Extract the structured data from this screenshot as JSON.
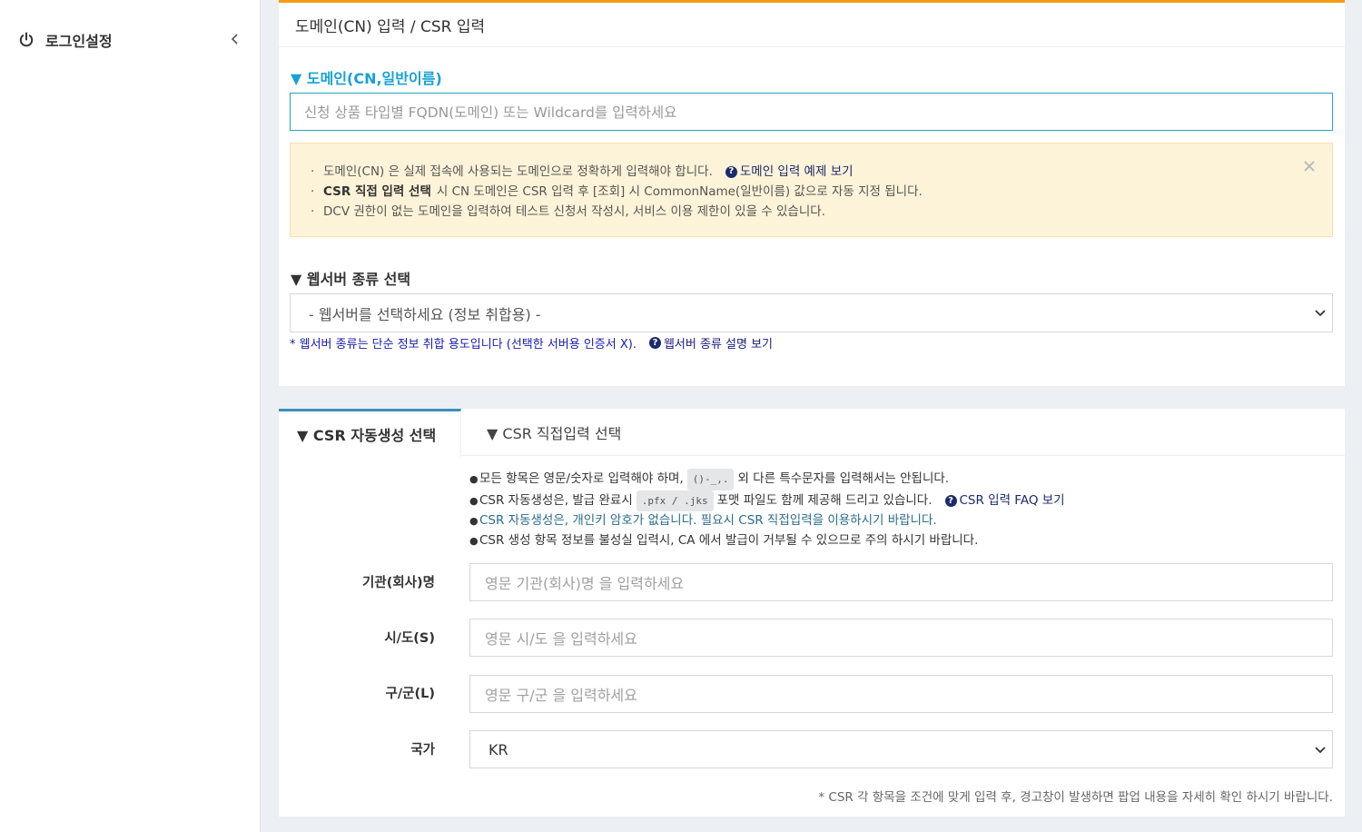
{
  "sidebar": {
    "items": [
      {
        "label": "로그인설정",
        "icon": "power-icon",
        "toggle_icon": "chevron-left-icon"
      }
    ]
  },
  "domain_card": {
    "header": "도메인(CN) 입력 / CSR 입력",
    "domain_section": {
      "title": "▼ 도메인(CN,일반이름)",
      "placeholder": "신청 상품 타입별 FQDN(도메인) 또는 Wildcard를 입력하세요"
    },
    "notice": {
      "lines": [
        {
          "bullet": "·",
          "bold": "",
          "text": "도메인(CN) 은 실제 접속에 사용되는 도메인으로 정확하게 입력해야 합니다.",
          "link": "도메인 입력 예제 보기"
        },
        {
          "bullet": "·",
          "bold": "CSR 직접 입력 선택",
          "text": "시 CN 도메인은 CSR 입력 후 [조회] 시 CommonName(일반이름) 값으로 자동 지정 됩니다.",
          "link": ""
        },
        {
          "bullet": "·",
          "bold": "",
          "text": "DCV 권한이 없는 도메인을 입력하여 테스트 신청서 작성시, 서비스 이용 제한이 있을 수 있습니다.",
          "link": ""
        }
      ]
    },
    "webserver_section": {
      "title": "▼ 웹서버 종류 선택",
      "selected": "- 웹서버를 선택하세요 (정보 취합용) -",
      "note": "* 웹서버 종류는 단순 정보 취합 용도입니다 (선택한 서버용 인증서 X).",
      "note_link": "웹서버 종류 설명 보기"
    }
  },
  "csr_card": {
    "tabs": [
      {
        "label": "▼ CSR 자동생성 선택",
        "active": true
      },
      {
        "label": "▼ CSR 직접입력 선택",
        "active": false
      }
    ],
    "rules": {
      "line1_pre": "모든 항목은 영문/숫자로 입력해야 하며,",
      "line1_code": "()-_,.",
      "line1_post": "외 다른 특수문자를 입력해서는 안됩니다.",
      "line2_pre": "CSR 자동생성은, 발급 완료시",
      "line2_code": ".pfx / .jks",
      "line2_post": "포맷 파일도 함께 제공해 드리고 있습니다.",
      "line2_link": "CSR 입력 FAQ 보기",
      "line3": "CSR 자동생성은, 개인키 암호가 없습니다. 필요시 CSR 직접입력을 이용하시기 바랍니다.",
      "line4": "CSR 생성 항목 정보를 불성실 입력시, CA 에서 발급이 거부될 수 있으므로 주의 하시기 바랍니다."
    },
    "fields": {
      "org": {
        "label": "기관(회사)명",
        "placeholder": "영문 기관(회사)명 을 입력하세요"
      },
      "state": {
        "label": "시/도(S)",
        "placeholder": "영문 시/도 을 입력하세요"
      },
      "locality": {
        "label": "구/군(L)",
        "placeholder": "영문 구/군 을 입력하세요"
      },
      "country": {
        "label": "국가",
        "value": "KR"
      }
    },
    "footer_note": "* CSR 각 항목을 조건에 맞게 입력 후, 경고창이 발생하면 팝업 내용을 자세히 확인 하시기 바랍니다."
  },
  "colors": {
    "accent_orange": "#f39c12",
    "domain_title": "#17a2d4",
    "active_tab": "#3c8dbc",
    "notice_bg": "#fdf3d8"
  }
}
